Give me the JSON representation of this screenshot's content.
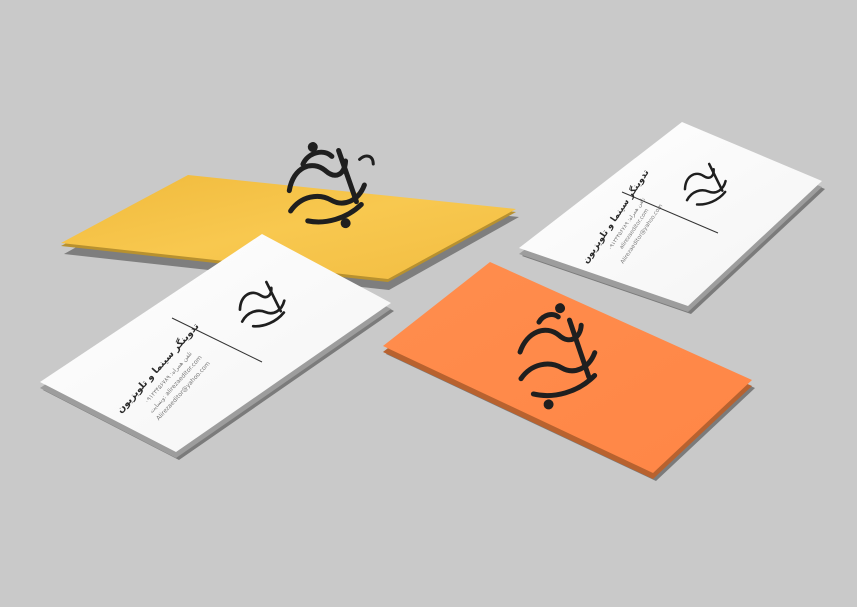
{
  "scene": {
    "background_color": "#c9c9c9",
    "card_count": 4
  },
  "cards": [
    {
      "id": "yellow",
      "side": "front",
      "color": "#f6c24a",
      "logo": "calligraphy-logo"
    },
    {
      "id": "white-right",
      "side": "back",
      "color": "#ffffff",
      "logo": "calligraphy-logo-small",
      "title": "تدوینگر سینما و تلویزیون",
      "lines": [
        "تلفن همراه: ۰۹۱۲۳۴۵۶۷۸۹",
        "alirezaeditor.com",
        "Alirezaeditor@yahoo.com"
      ]
    },
    {
      "id": "white-left",
      "side": "back",
      "color": "#ffffff",
      "logo": "calligraphy-logo-small",
      "title": "تدوینگر سینما و تلویزیون",
      "lines": [
        "تلفن همراه: ۰۹۱۲۳۴۵۶۷۸۹",
        "وبسایت: alirezaeditor.com",
        "Alirezaeditor@yahoo.com"
      ]
    },
    {
      "id": "orange",
      "side": "front",
      "color": "#ff8a4a",
      "logo": "calligraphy-logo"
    }
  ]
}
